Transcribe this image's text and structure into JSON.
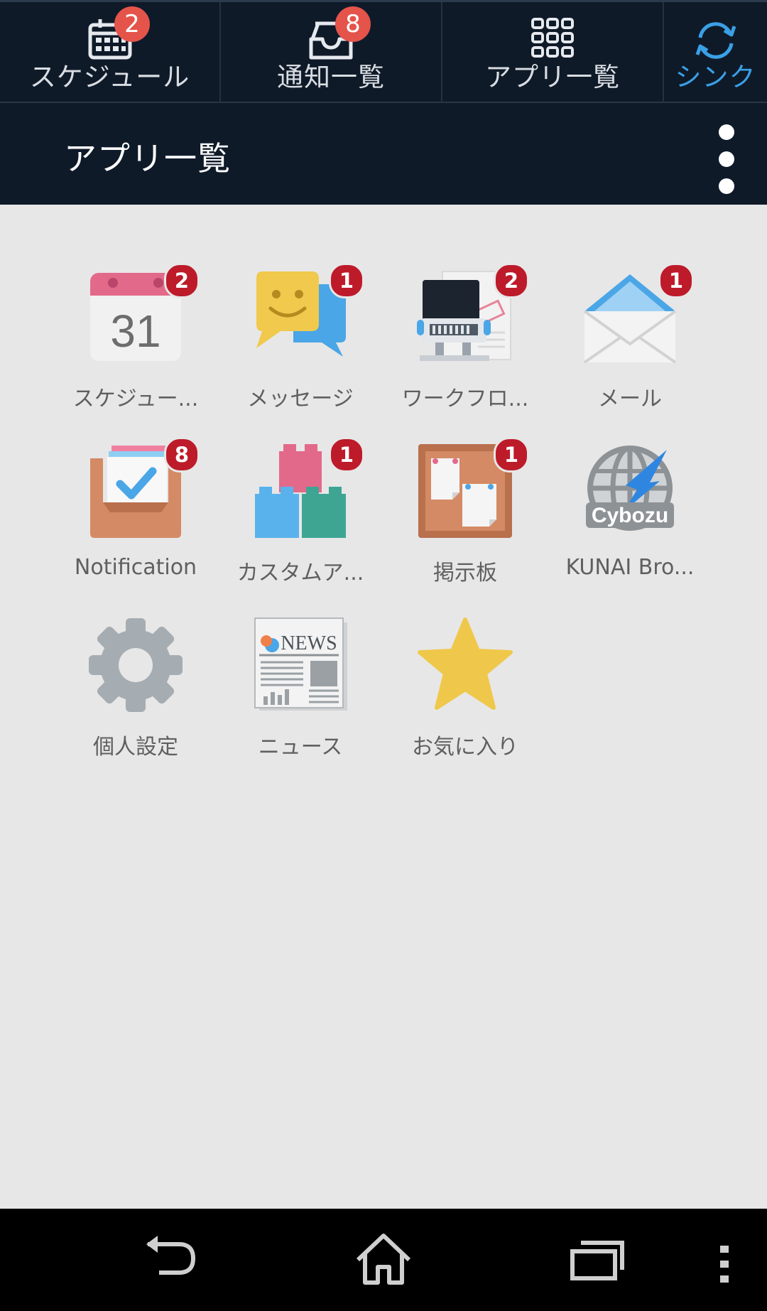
{
  "tabs": [
    {
      "label": "スケジュール",
      "badge": "2"
    },
    {
      "label": "通知一覧",
      "badge": "8"
    },
    {
      "label": "アプリ一覧",
      "badge": ""
    },
    {
      "label": "シンク",
      "badge": ""
    }
  ],
  "title": "アプリ一覧",
  "apps": [
    {
      "label": "スケジュー...",
      "badge": "2",
      "icon": "calendar-icon"
    },
    {
      "label": "メッセージ",
      "badge": "1",
      "icon": "message-icon"
    },
    {
      "label": "ワークフロ...",
      "badge": "2",
      "icon": "workflow-stamp-icon"
    },
    {
      "label": "メール",
      "badge": "1",
      "icon": "mail-icon"
    },
    {
      "label": "Notification",
      "badge": "8",
      "icon": "notification-tray-icon"
    },
    {
      "label": "カスタムア...",
      "badge": "1",
      "icon": "custom-app-blocks-icon"
    },
    {
      "label": "掲示板",
      "badge": "1",
      "icon": "bulletin-board-icon"
    },
    {
      "label": "KUNAI Bro...",
      "badge": "",
      "icon": "cybozu-globe-icon"
    },
    {
      "label": "個人設定",
      "badge": "",
      "icon": "gear-icon"
    },
    {
      "label": "ニュース",
      "badge": "",
      "icon": "newspaper-icon"
    },
    {
      "label": "お気に入り",
      "badge": "",
      "icon": "star-icon"
    }
  ],
  "icon_texts": {
    "calendar_day": "31",
    "cybozu": "Cybozu",
    "news": "NEWS"
  },
  "colors": {
    "tab_bg": "#0f1a29",
    "sync_accent": "#3aa0e6",
    "tab_badge": "#e4544a",
    "app_badge": "#bd1b2a",
    "grid_bg": "#e7e7e7"
  }
}
